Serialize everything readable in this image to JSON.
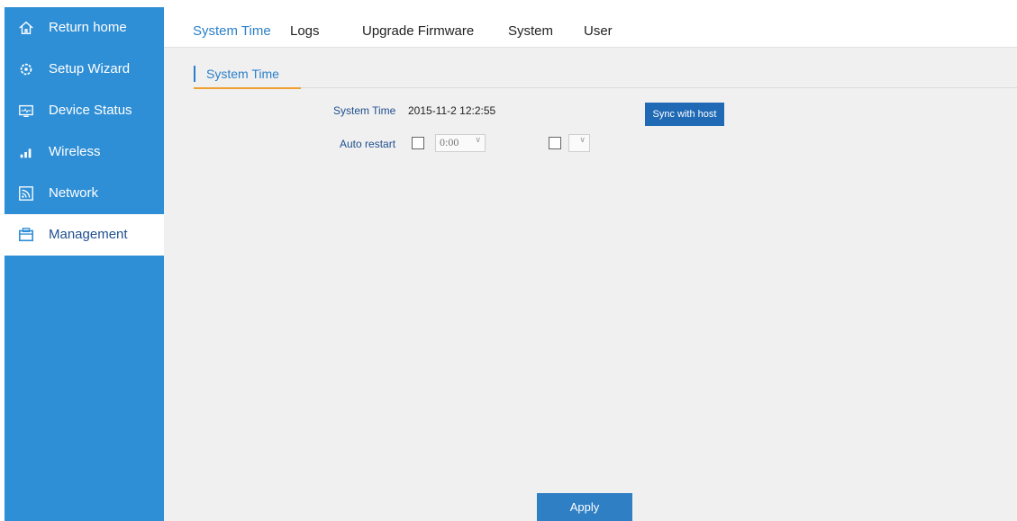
{
  "sidebar": {
    "items": [
      {
        "label": "Return home",
        "icon": "home-icon"
      },
      {
        "label": "Setup Wizard",
        "icon": "gear-icon"
      },
      {
        "label": "Device Status",
        "icon": "monitor-icon"
      },
      {
        "label": "Wireless",
        "icon": "signal-bars-icon"
      },
      {
        "label": "Network",
        "icon": "network-icon"
      },
      {
        "label": "Management",
        "icon": "toolbox-icon",
        "active": true
      }
    ]
  },
  "tabs": [
    {
      "label": "System Time",
      "active": true
    },
    {
      "label": "Logs"
    },
    {
      "label": "Upgrade Firmware"
    },
    {
      "label": "System"
    },
    {
      "label": "User"
    }
  ],
  "section": {
    "title": "System Time"
  },
  "system_time": {
    "label": "System Time",
    "value": "2015-11-2 12:2:55",
    "sync_button": "Sync with host"
  },
  "auto_restart": {
    "label": "Auto restart",
    "time_select_value": "0:00",
    "second_select_value": ""
  },
  "apply_button": "Apply",
  "colors": {
    "sidebar_bg": "#2f8fd6",
    "accent": "#2b7fc9",
    "tab_underline": "#f0a030",
    "button": "#2069b5"
  }
}
